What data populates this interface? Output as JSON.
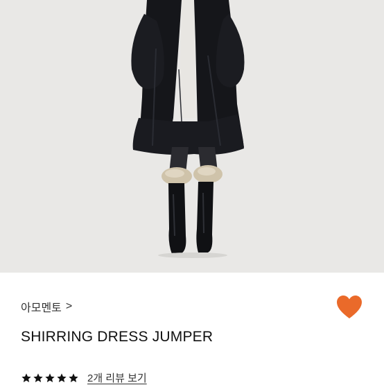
{
  "product": {
    "brand_label": "아모멘토",
    "brand_chevron": ">",
    "title": "SHIRRING DRESS JUMPER",
    "rating": 5,
    "rating_max": 5,
    "review_link": "2개 리뷰 보기",
    "wishlisted": true
  },
  "icons": {
    "wishlist": "heart-icon",
    "star": "star-icon",
    "brand_chevron": "chevron-right-icon"
  },
  "colors": {
    "heart": "#ea6a2a",
    "star": "#111111",
    "photo_background": "#e9e8e6",
    "text_primary": "#111111"
  }
}
